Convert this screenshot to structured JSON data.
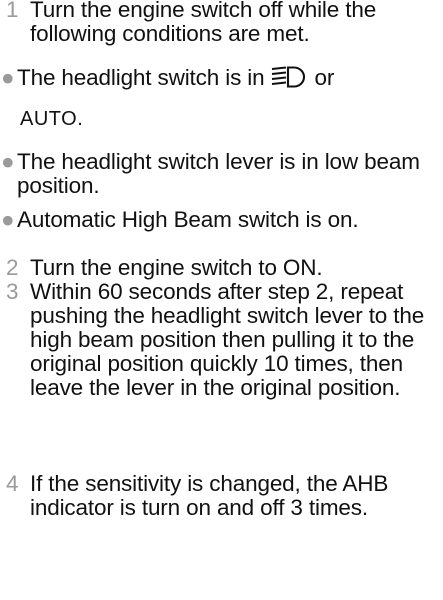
{
  "steps": [
    {
      "num": "1",
      "text": "Turn the engine switch off while the following conditions are met."
    },
    {
      "num": "2",
      "text": "Turn the engine switch to ON."
    },
    {
      "num": "3",
      "text": "Within 60 seconds after step 2, repeat pushing the headlight switch lever to the high beam position then pulling it to the original position quickly 10 times, then leave the lever in the original position."
    },
    {
      "num": "4",
      "text": "If the sensitivity is changed, the AHB indicator is turn on and off 3 times."
    }
  ],
  "conditions": {
    "bullet": "●",
    "headlight_prefix": "The headlight switch is in",
    "headlight_or": "or",
    "headlight_icon": "low-beam-headlight-icon",
    "auto_label": "AUTO",
    "auto_period": ".",
    "lever": "The headlight switch lever is in low beam position.",
    "ahb": "Automatic High Beam switch is on."
  }
}
